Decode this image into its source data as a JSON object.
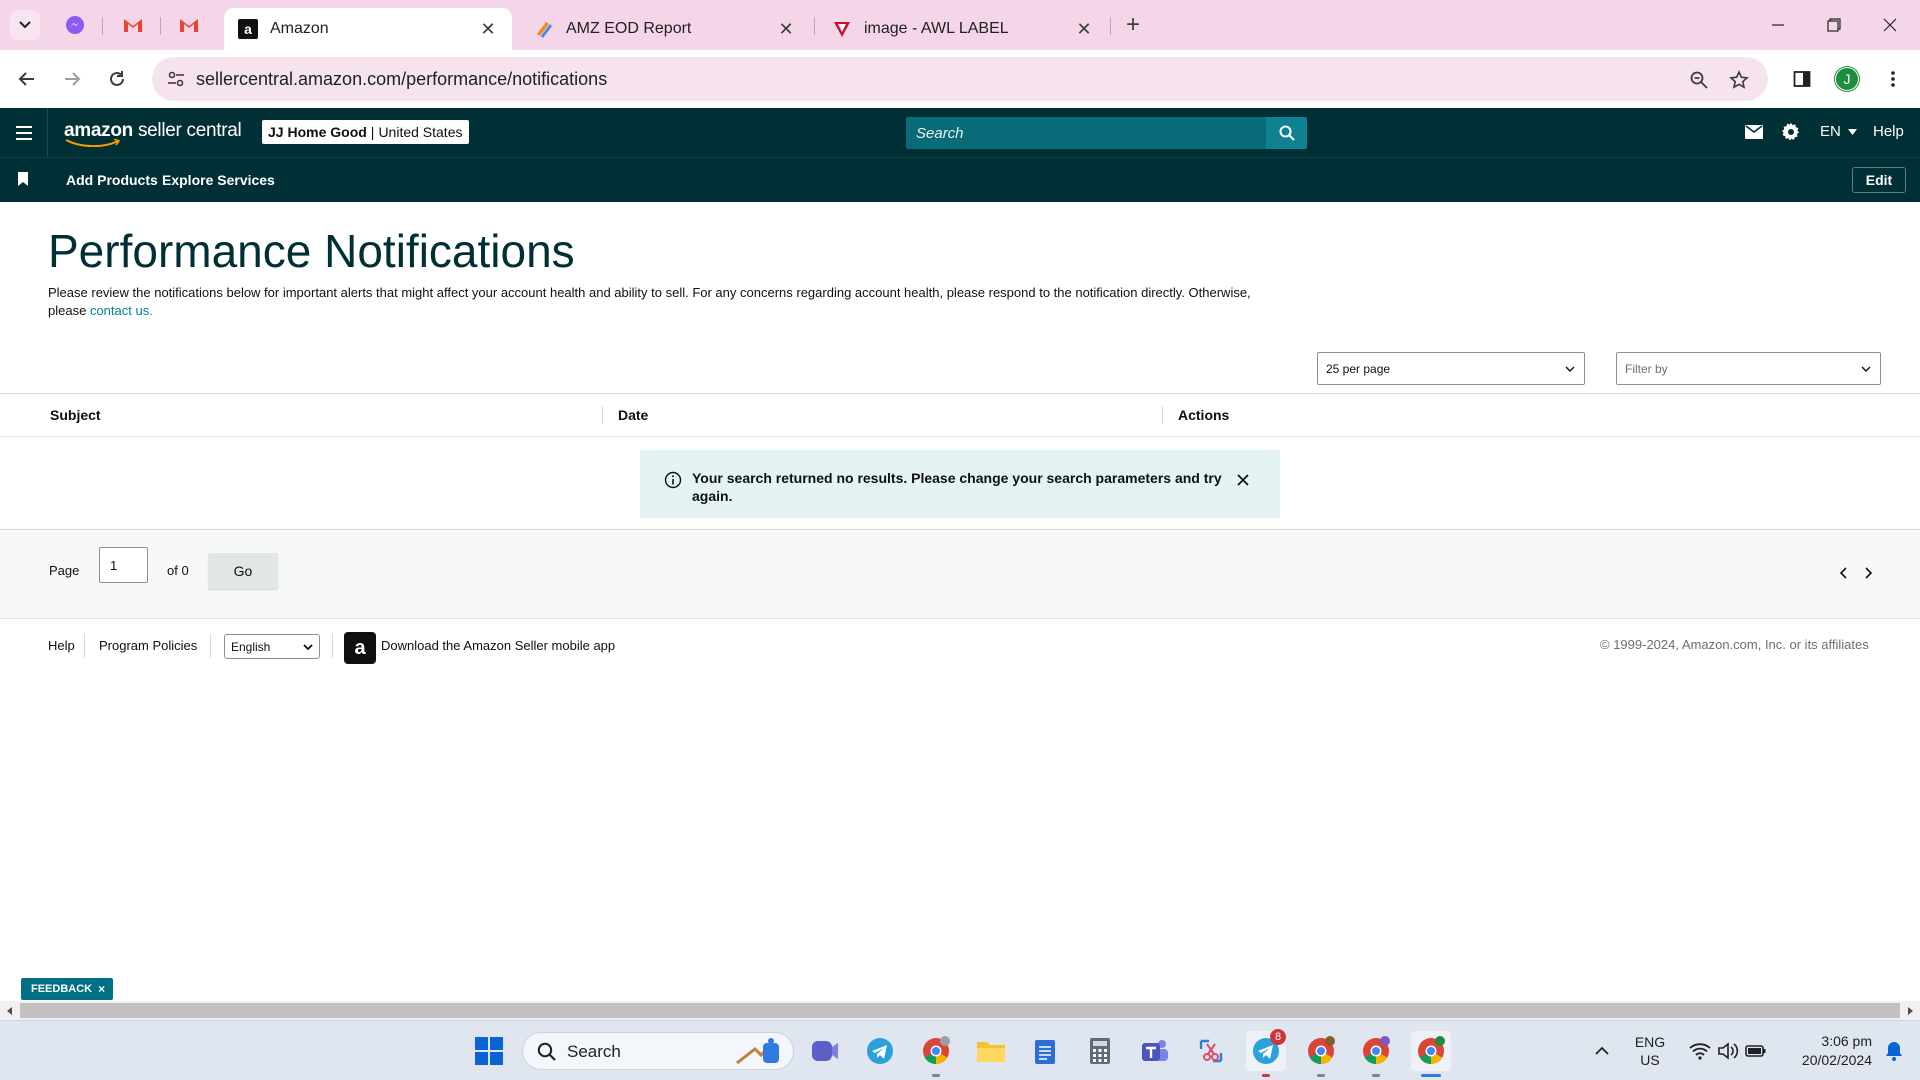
{
  "browser": {
    "tabs": [
      {
        "title": "Amazon",
        "active": true
      },
      {
        "title": "AMZ EOD Report",
        "active": false
      },
      {
        "title": "image - AWL LABEL",
        "active": false
      }
    ],
    "url": "sellercentral.amazon.com/performance/notifications",
    "profile_initial": "J"
  },
  "header": {
    "logo_amazon": "amazon",
    "logo_rest": "seller central",
    "account_name": "JJ Home Good",
    "account_sep": "|",
    "account_region": "United States",
    "search_placeholder": "Search",
    "language": "EN",
    "help": "Help"
  },
  "subnav": {
    "items": [
      "Add Products",
      "Explore Services"
    ],
    "edit": "Edit"
  },
  "page": {
    "title": "Performance Notifications",
    "desc_main": "Please review the notifications below for important alerts that might affect your account health and ability to sell. For any concerns regarding account health, please respond to the notification directly. Otherwise, please",
    "desc_link": "contact us.",
    "per_page": "25 per page",
    "filter_placeholder": "Filter by"
  },
  "table": {
    "columns": [
      "Subject",
      "Date",
      "Actions"
    ],
    "empty_message": "Your search returned no results. Please change your search parameters and try again."
  },
  "pager": {
    "page_label": "Page",
    "page_value": "1",
    "of_label": "of 0",
    "go": "Go"
  },
  "footer": {
    "help": "Help",
    "program_policies": "Program Policies",
    "language": "English",
    "app_text": "Download the Amazon Seller mobile app",
    "copyright": "© 1999-2024, Amazon.com, Inc. or its affiliates"
  },
  "feedback": {
    "label": "FEEDBACK",
    "close": "×"
  },
  "taskbar": {
    "search_label": "Search",
    "telegram_badge": "8",
    "lang_top": "ENG",
    "lang_bottom": "US",
    "time": "3:06 pm",
    "date": "20/02/2024"
  },
  "colors": {
    "header_bg": "#002f36",
    "accent": "#008296",
    "alert_bg": "#e6f3f4",
    "tabstrip_bg": "#f5d6e8"
  }
}
